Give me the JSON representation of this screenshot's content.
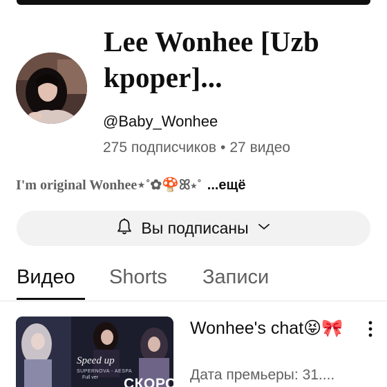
{
  "channel": {
    "name": "Lee Wonhee [Uzb kpoper]...",
    "handle": "@Baby_Wonhee",
    "subscribers": "275 подписчиков",
    "separator": "•",
    "videos_count": "27 видео",
    "description": "I'm original Wonhee⋆˚✿🍄ꕤ⋆˚",
    "more_label": "...ещё",
    "avatar_icon": "channel-avatar"
  },
  "subscribe": {
    "label": "Вы подписаны",
    "bell_icon": "bell-icon",
    "chevron_icon": "chevron-down-icon"
  },
  "tabs": [
    {
      "label": "Видео",
      "active": true
    },
    {
      "label": "Shorts",
      "active": false
    },
    {
      "label": "Записи",
      "active": false
    }
  ],
  "videos": [
    {
      "title": "Wonhee's chat😝🎀",
      "meta": "Дата премьеры: 31....",
      "thumbnail": {
        "overlay_title": "Speed up",
        "overlay_song": "SUPERNOVA - AESPA",
        "overlay_version": "Full ver",
        "overlay_badge": "СКОРО"
      }
    }
  ],
  "colors": {
    "text_primary": "#0f0f0f",
    "text_secondary": "#606060",
    "button_bg": "#f2f2f2",
    "divider": "#e5e5e5"
  }
}
